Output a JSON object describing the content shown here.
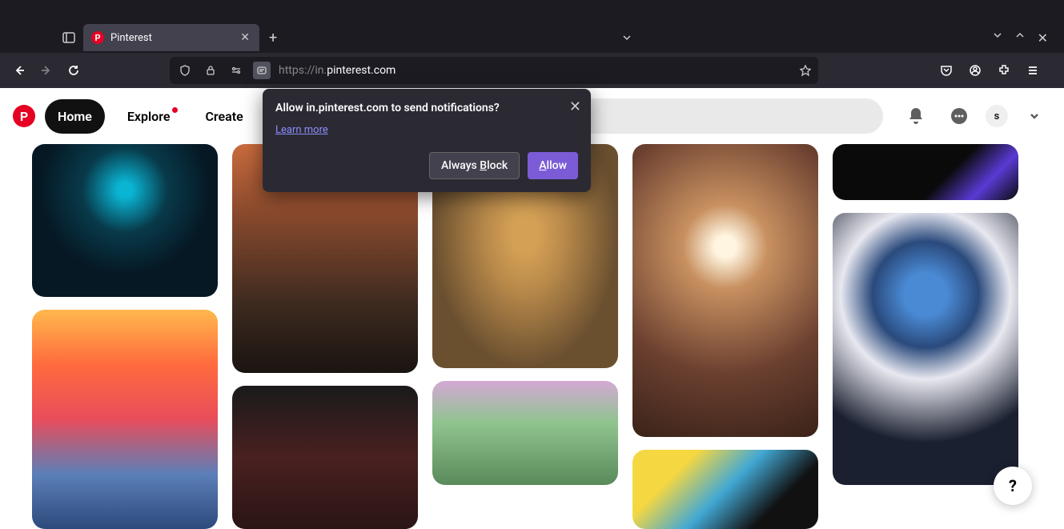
{
  "browser": {
    "tab": {
      "title": "Pinterest",
      "favicon_letter": "P"
    },
    "url_prefix": "https://in.",
    "url_domain": "pinterest.com"
  },
  "pinterest": {
    "logo_letter": "P",
    "nav": {
      "home": "Home",
      "explore": "Explore",
      "create": "Create"
    },
    "avatar_letter": "s",
    "help": "?"
  },
  "notification": {
    "title": "Allow in.pinterest.com to send notifications?",
    "learn_more": "Learn more",
    "block_prefix": "Always ",
    "block_letter": "B",
    "block_suffix": "lock",
    "allow_letter": "A",
    "allow_suffix": "llow"
  }
}
